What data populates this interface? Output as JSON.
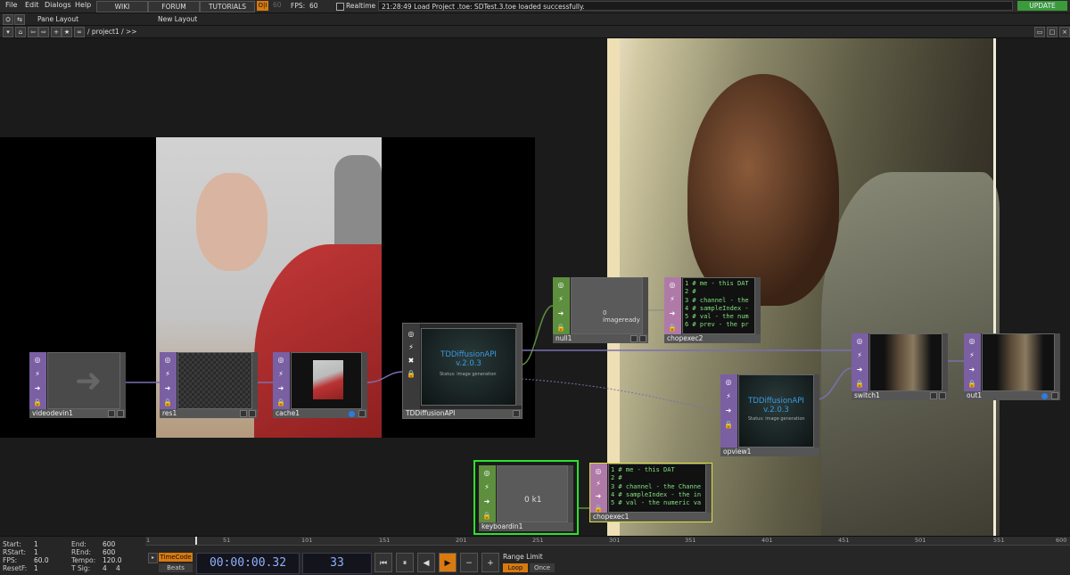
{
  "menu": [
    "File",
    "Edit",
    "Dialogs",
    "Help"
  ],
  "top_buttons": {
    "wiki": "WIKI",
    "forum": "FORUM",
    "tutorials": "TUTORIALS"
  },
  "perform_label": "O|I",
  "fps_button": "60",
  "fps": {
    "label": "FPS:",
    "value": "60"
  },
  "realtime_label": "Realtime",
  "status_message": "21:28:49 Load Project .toe: SDTest.3.toe loaded successfully.",
  "update_label": "UPDATE",
  "layout": {
    "pane": "Pane Layout",
    "new": "New Layout"
  },
  "path": "/ project1 / >>",
  "nodes": {
    "videodevin": "videodevin1",
    "res": "res1",
    "cache": "cache1",
    "tddiffusion": "TDDiffusionAPI",
    "tddiffusion_title": "TDDiffusionAPI\nv.2.0.3",
    "tddiffusion_status": "Status: image generation",
    "null": "null1",
    "null_text": "0 imageready",
    "chopexec2": "chopexec2",
    "chopexec2_code": "1 # me - this DAT\n2 #\n3 # channel - the\n4 # sampleIndex -\n5 # val - the num\n6 # prev - the pr",
    "switch": "switch1",
    "out": "out1",
    "opview": "opview1",
    "opview_title": "TDDiffusionAPI\nv.2.0.3",
    "opview_status": "Status: image generation",
    "keyboardin": "keyboardin1",
    "keyboardin_text": "0 k1",
    "chopexec1": "chopexec1",
    "chopexec1_code": "1 # me - this DAT\n2 #\n3 # channel - the Channe\n4 # sampleIndex - the in\n5 # val - the numeric va"
  },
  "timeline": {
    "start": {
      "label": "Start:",
      "value": "1"
    },
    "end": {
      "label": "End:",
      "value": "600"
    },
    "rstart": {
      "label": "RStart:",
      "value": "1"
    },
    "rend": {
      "label": "REnd:",
      "value": "600"
    },
    "fps": {
      "label": "FPS:",
      "value": "60.0"
    },
    "tempo": {
      "label": "Tempo:",
      "value": "120.0"
    },
    "resetf": {
      "label": "ResetF:",
      "value": "1"
    },
    "tsig": {
      "label": "T Sig:",
      "value1": "4",
      "value2": "4"
    },
    "ticks": [
      "1",
      "51",
      "101",
      "151",
      "201",
      "251",
      "301",
      "351",
      "401",
      "451",
      "501",
      "551",
      "600"
    ],
    "timecode_label": "TimeCode",
    "beats_label": "Beats",
    "timecode": "00:00:00.32",
    "frame": "33",
    "range_label": "Range Limit",
    "loop_label": "Loop",
    "once_label": "Once"
  },
  "colors": {
    "accent": "#d97a10",
    "update": "#3b9b3b",
    "top_tab": "#7a5fa3",
    "chop_tab": "#5d8f3e",
    "dat_tab": "#b07aa8"
  }
}
